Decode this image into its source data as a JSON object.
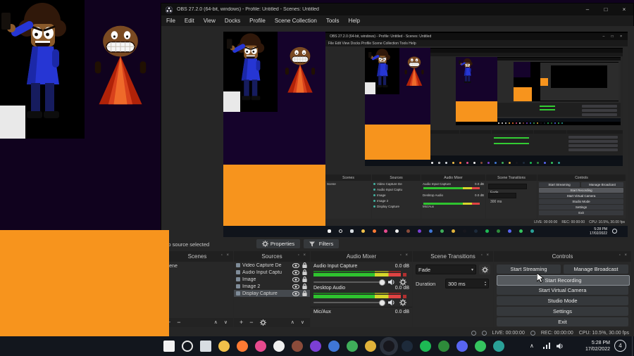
{
  "window": {
    "title": "OBS 27.2.0 (64-bit, windows) - Profile: Untitled - Scenes: Untitled",
    "menu": [
      "File",
      "Edit",
      "View",
      "Docks",
      "Profile",
      "Scene Collection",
      "Tools",
      "Help"
    ],
    "menu_line": "File    Edit    View    Docks    Profile    Scene Collection    Tools    Help",
    "buttons": {
      "minimize": "–",
      "maximize": "□",
      "close": "×"
    }
  },
  "properties_bar": {
    "label": "No source selected",
    "properties_btn": "Properties",
    "filters_btn": "Filters"
  },
  "docks": {
    "scenes": {
      "title": "Scenes",
      "items": [
        "Scene"
      ]
    },
    "sources": {
      "title": "Sources",
      "rows": [
        {
          "label": "Video Capture De"
        },
        {
          "label": "Audio Input Captu"
        },
        {
          "label": "Image"
        },
        {
          "label": "Image 2"
        },
        {
          "label": "Display Capture"
        }
      ]
    },
    "mixer": {
      "title": "Audio Mixer",
      "channels": [
        {
          "name": "Audio Input Capture",
          "db": "0.0 dB"
        },
        {
          "name": "Desktop Audio",
          "db": "0.0 dB"
        },
        {
          "name": "Mic/Aux",
          "db": "0.0 dB"
        }
      ]
    },
    "transitions": {
      "title": "Scene Transitions",
      "selected": "Fade",
      "duration_label": "Duration",
      "duration_value": "300 ms"
    },
    "controls": {
      "title": "Controls",
      "buttons": [
        "Start Streaming",
        "Manage Broadcast",
        "Start Recording",
        "Start Virtual Camera",
        "Studio Mode",
        "Settings",
        "Exit"
      ]
    }
  },
  "status_bar": {
    "live": "LIVE: 00:00:00",
    "rec": "REC: 00:00:00",
    "cpu": "CPU: 10.5%, 30.00 fps"
  },
  "taskbar": {
    "time": "5:28 PM",
    "date": "17/02/2022",
    "badge": "4",
    "icons": [
      {
        "name": "notepad",
        "color": "#f2f2f2",
        "shape": "square"
      },
      {
        "name": "search",
        "color": "#e6e6e6",
        "shape": "ring"
      },
      {
        "name": "task-view",
        "color": "#d8dde2",
        "shape": "square"
      },
      {
        "name": "file-explorer",
        "color": "#f0c04a"
      },
      {
        "name": "firefox",
        "color": "#ff7a33"
      },
      {
        "name": "music-app",
        "color": "#e64a8e"
      },
      {
        "name": "krita",
        "color": "#efefef"
      },
      {
        "name": "app-brown",
        "color": "#8a4b3a"
      },
      {
        "name": "game-purple",
        "color": "#7b3fd4"
      },
      {
        "name": "app-blue",
        "color": "#3f77d6"
      },
      {
        "name": "app-green",
        "color": "#3fae5a"
      },
      {
        "name": "app-gold",
        "color": "#e0b23a"
      },
      {
        "name": "obs-studio",
        "color": "#17171d",
        "active": true
      },
      {
        "name": "steam",
        "color": "#1d2a3a"
      },
      {
        "name": "spotify",
        "color": "#1db954"
      },
      {
        "name": "sharex",
        "color": "#2e8b3a"
      },
      {
        "name": "discord",
        "color": "#5865f2"
      },
      {
        "name": "whatsapp",
        "color": "#35c45f"
      },
      {
        "name": "app-teal",
        "color": "#2aa198"
      }
    ]
  },
  "colors": {
    "orange": "#f7941d",
    "meter_green": "#2fc42f",
    "meter_yellow": "#d6d62a",
    "meter_red": "#e04343"
  }
}
